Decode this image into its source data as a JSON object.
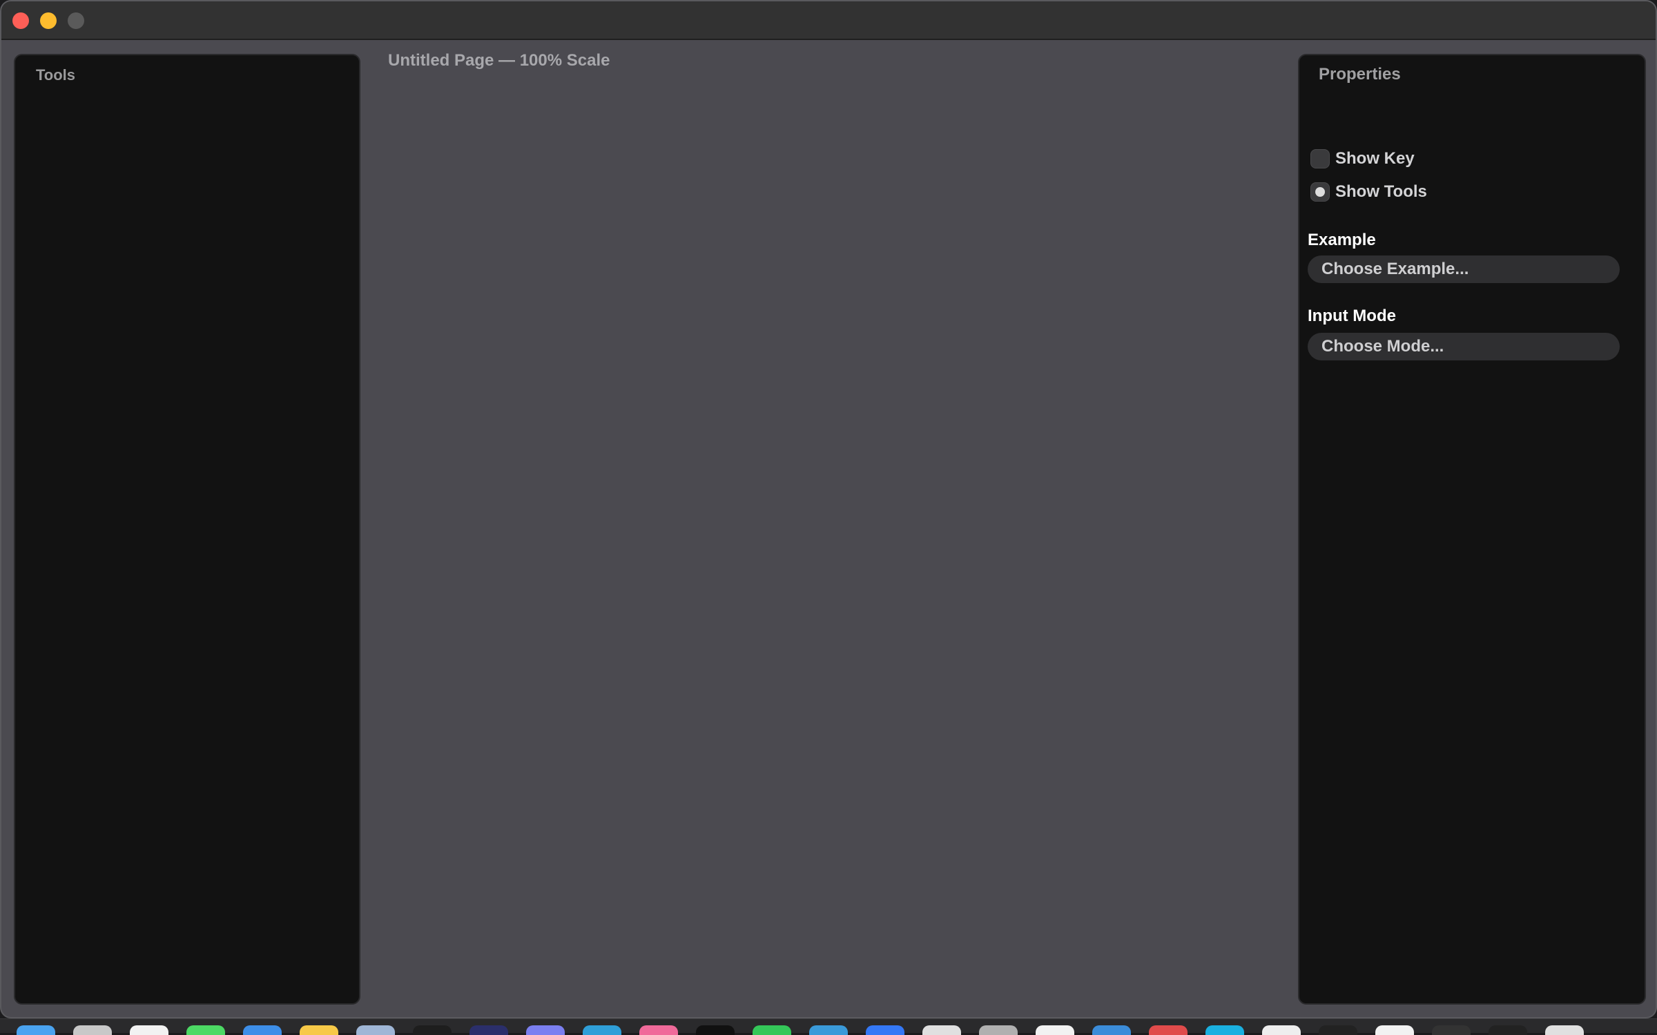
{
  "window": {
    "traffic_lights": [
      "close",
      "minimize",
      "maximize"
    ]
  },
  "left_panel": {
    "title": "Tools"
  },
  "main": {
    "document_title": "Untitled Page — 100% Scale"
  },
  "inspector": {
    "title": "Properties",
    "options": [
      {
        "label": "Show Key",
        "checked": false
      },
      {
        "label": "Show Tools",
        "checked": true
      }
    ],
    "example_label": "Example",
    "example_selector": "Choose Example...",
    "input_label": "Input Mode",
    "input_selector": "Choose Mode..."
  },
  "colors": {
    "window_bg": "#4b4a50",
    "panel_bg": "#121212",
    "titlebar": "#323232",
    "close": "#fe5f57",
    "minimize": "#febc2e"
  },
  "dock": {
    "icons": [
      "finder-icon",
      "launchpad-icon",
      "safari-icon",
      "messages-icon",
      "folder-icon",
      "notes-icon",
      "preview-icon",
      "terminal-icon",
      "app-icon",
      "discord-icon",
      "app-icon",
      "photos-icon",
      "app-icon",
      "app-icon",
      "app-icon",
      "app-icon",
      "app-icon",
      "app-icon",
      "app-icon",
      "app-icon",
      "app-icon",
      "app-icon",
      "app-icon",
      "app-icon",
      "app-icon",
      "app-icon",
      "app-icon",
      "app-icon"
    ]
  }
}
